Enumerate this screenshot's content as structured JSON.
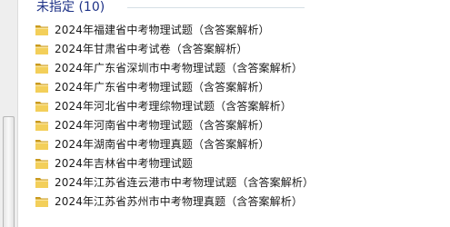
{
  "group": {
    "title": "未指定 (10)"
  },
  "icons": {
    "folder": "folder-icon"
  },
  "items": [
    {
      "name": "2024年福建省中考物理试题（含答案解析）"
    },
    {
      "name": "2024年甘肃省中考试卷（含答案解析）"
    },
    {
      "name": "2024年广东省深圳市中考物理试题（含答案解析）"
    },
    {
      "name": "2024年广东省中考物理试题（含答案解析）"
    },
    {
      "name": "2024年河北省中考理综物理试题（含答案解析）"
    },
    {
      "name": "2024年河南省中考物理试题（含答案解析）"
    },
    {
      "name": "2024年湖南省中考物理真题（含答案解析）"
    },
    {
      "name": "2024年吉林省中考物理试题"
    },
    {
      "name": "2024年江苏省连云港市中考物理试题（含答案解析）"
    },
    {
      "name": "2024年江苏省苏州市中考物理真题（含答案解析）"
    }
  ]
}
